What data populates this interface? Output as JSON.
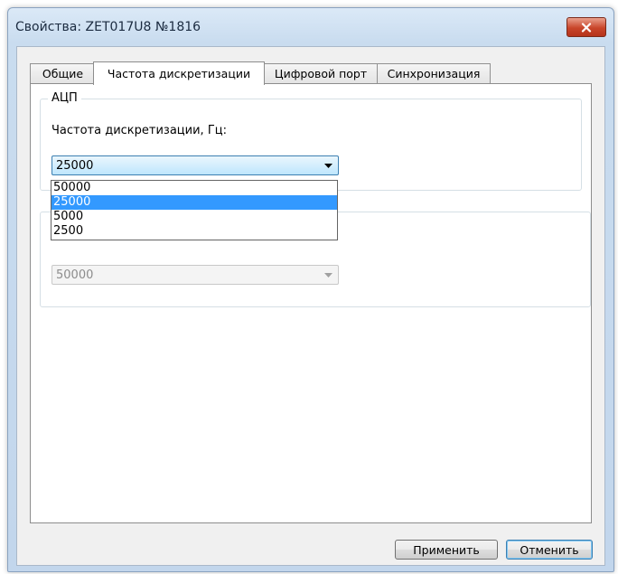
{
  "window": {
    "title": "Свойства: ZET017U8 №1816"
  },
  "tabs": [
    {
      "label": "Общие"
    },
    {
      "label": "Частота дискретизации"
    },
    {
      "label": "Цифровой порт"
    },
    {
      "label": "Синхронизация"
    }
  ],
  "adc_group": {
    "label": "АЦП",
    "freq_label": "Частота дискретизации, Гц:",
    "selected": "25000",
    "options": [
      "50000",
      "25000",
      "5000",
      "2500"
    ]
  },
  "second_group": {
    "combo_value": "50000"
  },
  "buttons": {
    "apply": "Применить",
    "cancel": "Отменить"
  },
  "colors": {
    "selection": "#3399ff",
    "close_button": "#c8452a",
    "window_frame": "#c9dcef"
  }
}
